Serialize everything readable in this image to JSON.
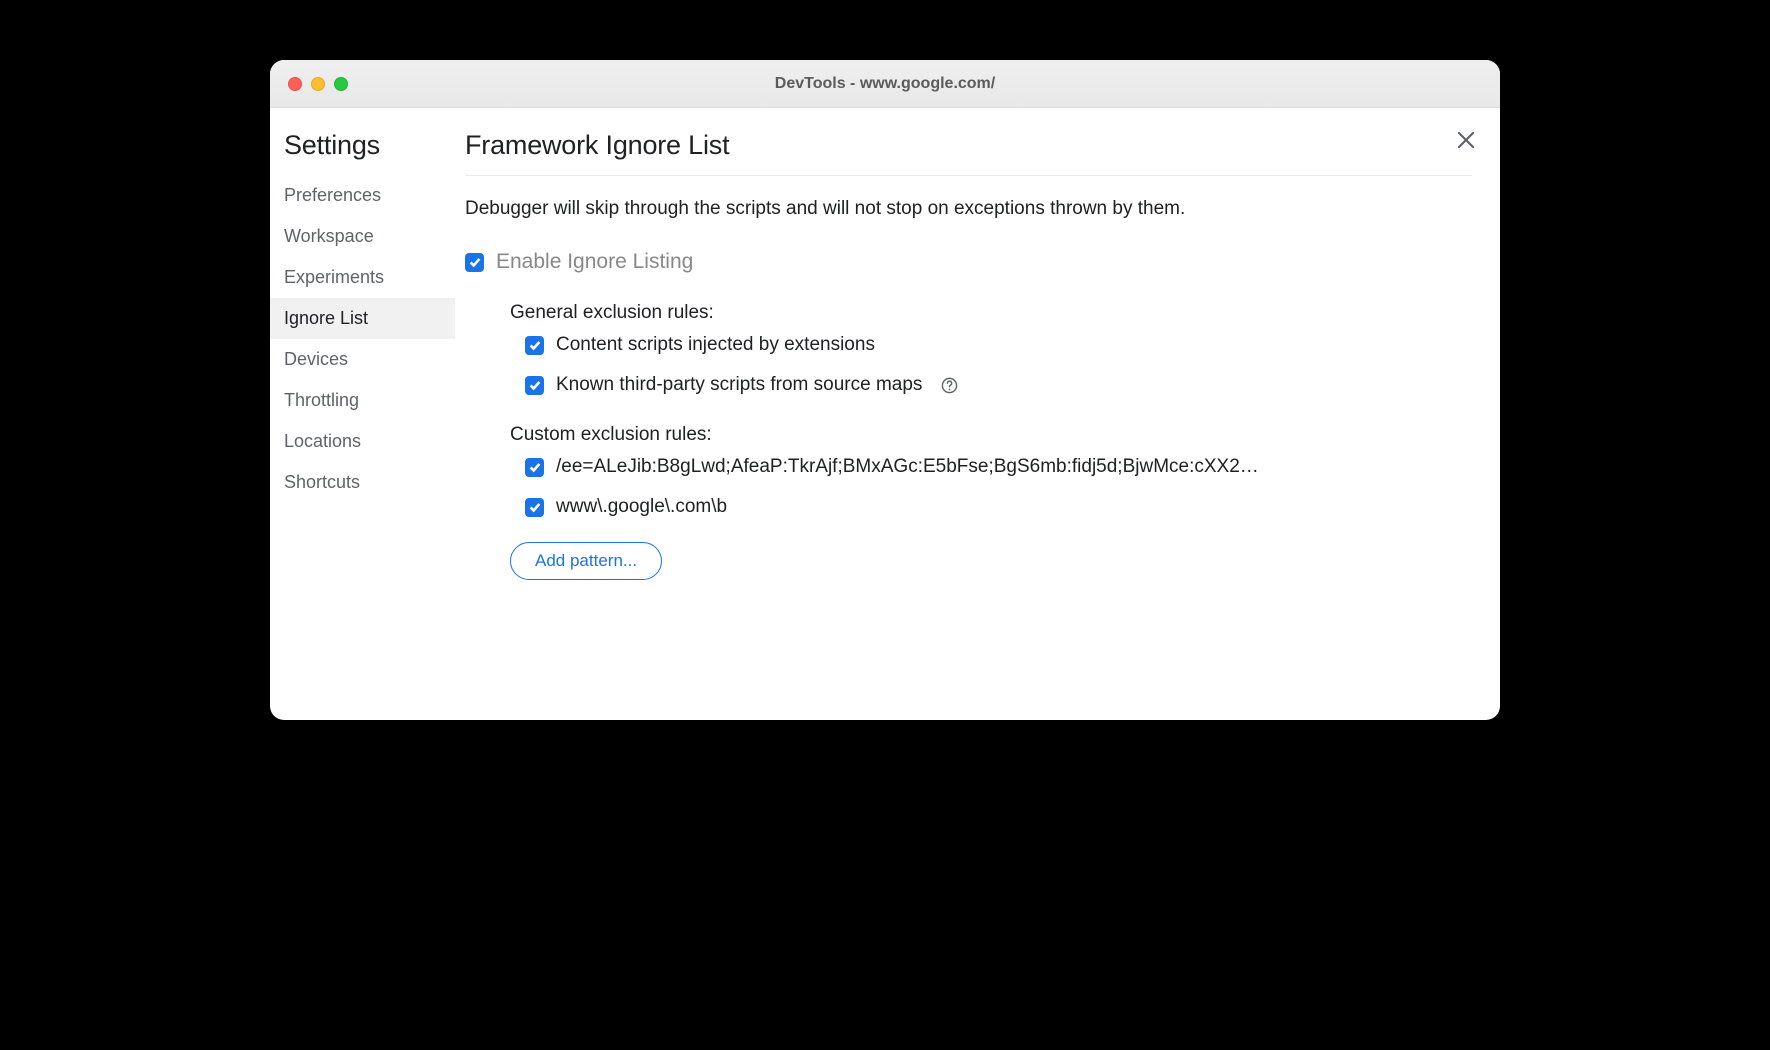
{
  "window": {
    "title": "DevTools - www.google.com/"
  },
  "sidebar": {
    "title": "Settings",
    "items": [
      {
        "label": "Preferences",
        "active": false
      },
      {
        "label": "Workspace",
        "active": false
      },
      {
        "label": "Experiments",
        "active": false
      },
      {
        "label": "Ignore List",
        "active": true
      },
      {
        "label": "Devices",
        "active": false
      },
      {
        "label": "Throttling",
        "active": false
      },
      {
        "label": "Locations",
        "active": false
      },
      {
        "label": "Shortcuts",
        "active": false
      }
    ]
  },
  "main": {
    "title": "Framework Ignore List",
    "description": "Debugger will skip through the scripts and will not stop on exceptions thrown by them.",
    "enable_label": "Enable Ignore Listing",
    "enable_checked": true,
    "general_heading": "General exclusion rules:",
    "general_rules": [
      {
        "label": "Content scripts injected by extensions",
        "checked": true,
        "help": false
      },
      {
        "label": "Known third-party scripts from source maps",
        "checked": true,
        "help": true
      }
    ],
    "custom_heading": "Custom exclusion rules:",
    "custom_rules": [
      {
        "label": "/ee=ALeJib:B8gLwd;AfeaP:TkrAjf;BMxAGc:E5bFse;BgS6mb:fidj5d;BjwMce:cXX2…",
        "checked": true
      },
      {
        "label": "www\\.google\\.com\\b",
        "checked": true
      }
    ],
    "add_pattern_label": "Add pattern..."
  }
}
